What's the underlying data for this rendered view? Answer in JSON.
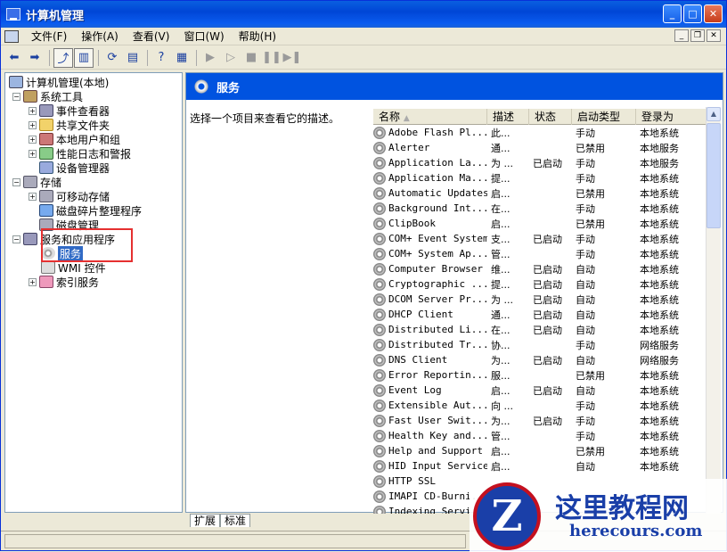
{
  "window": {
    "title": "计算机管理"
  },
  "menu": [
    "文件(F)",
    "操作(A)",
    "查看(V)",
    "窗口(W)",
    "帮助(H)"
  ],
  "tree": {
    "root": "计算机管理(本地)",
    "system_tools": "系统工具",
    "event_viewer": "事件查看器",
    "shared_folders": "共享文件夹",
    "local_users": "本地用户和组",
    "perf_logs": "性能日志和警报",
    "device_manager": "设备管理器",
    "storage": "存储",
    "removable": "可移动存储",
    "defrag": "磁盘碎片整理程序",
    "disk_mgmt": "磁盘管理",
    "services_apps": "服务和应用程序",
    "services": "服务",
    "wmi": "WMI 控件",
    "indexing": "索引服务"
  },
  "panel": {
    "title": "服务",
    "description": "选择一个项目来查看它的描述。"
  },
  "columns": [
    "名称",
    "描述",
    "状态",
    "启动类型",
    "登录为"
  ],
  "services": [
    {
      "name": "Adobe Flash Pl...",
      "desc": "此...",
      "status": "",
      "startup": "手动",
      "logon": "本地系统"
    },
    {
      "name": "Alerter",
      "desc": "通...",
      "status": "",
      "startup": "已禁用",
      "logon": "本地服务"
    },
    {
      "name": "Application La...",
      "desc": "为 ...",
      "status": "已启动",
      "startup": "手动",
      "logon": "本地服务"
    },
    {
      "name": "Application Ma...",
      "desc": "提...",
      "status": "",
      "startup": "手动",
      "logon": "本地系统"
    },
    {
      "name": "Automatic Updates",
      "desc": "启...",
      "status": "",
      "startup": "已禁用",
      "logon": "本地系统"
    },
    {
      "name": "Background Int...",
      "desc": "在...",
      "status": "",
      "startup": "手动",
      "logon": "本地系统"
    },
    {
      "name": "ClipBook",
      "desc": "启...",
      "status": "",
      "startup": "已禁用",
      "logon": "本地系统"
    },
    {
      "name": "COM+ Event System",
      "desc": "支...",
      "status": "已启动",
      "startup": "手动",
      "logon": "本地系统"
    },
    {
      "name": "COM+ System Ap...",
      "desc": "管...",
      "status": "",
      "startup": "手动",
      "logon": "本地系统"
    },
    {
      "name": "Computer Browser",
      "desc": "维...",
      "status": "已启动",
      "startup": "自动",
      "logon": "本地系统"
    },
    {
      "name": "Cryptographic ...",
      "desc": "提...",
      "status": "已启动",
      "startup": "自动",
      "logon": "本地系统"
    },
    {
      "name": "DCOM Server Pr...",
      "desc": "为 ...",
      "status": "已启动",
      "startup": "自动",
      "logon": "本地系统"
    },
    {
      "name": "DHCP Client",
      "desc": "通...",
      "status": "已启动",
      "startup": "自动",
      "logon": "本地系统"
    },
    {
      "name": "Distributed Li...",
      "desc": "在...",
      "status": "已启动",
      "startup": "自动",
      "logon": "本地系统"
    },
    {
      "name": "Distributed Tr...",
      "desc": "协...",
      "status": "",
      "startup": "手动",
      "logon": "网络服务"
    },
    {
      "name": "DNS Client",
      "desc": "为...",
      "status": "已启动",
      "startup": "自动",
      "logon": "网络服务"
    },
    {
      "name": "Error Reportin...",
      "desc": "服...",
      "status": "",
      "startup": "已禁用",
      "logon": "本地系统"
    },
    {
      "name": "Event Log",
      "desc": "启...",
      "status": "已启动",
      "startup": "自动",
      "logon": "本地系统"
    },
    {
      "name": "Extensible Aut...",
      "desc": "向 ...",
      "status": "",
      "startup": "手动",
      "logon": "本地系统"
    },
    {
      "name": "Fast User Swit...",
      "desc": "为...",
      "status": "已启动",
      "startup": "手动",
      "logon": "本地系统"
    },
    {
      "name": "Health Key and...",
      "desc": "管...",
      "status": "",
      "startup": "手动",
      "logon": "本地系统"
    },
    {
      "name": "Help and Support",
      "desc": "启...",
      "status": "",
      "startup": "已禁用",
      "logon": "本地系统"
    },
    {
      "name": "HID Input Service",
      "desc": "启...",
      "status": "",
      "startup": "自动",
      "logon": "本地系统"
    },
    {
      "name": "HTTP SSL",
      "desc": "",
      "status": "",
      "startup": "",
      "logon": ""
    },
    {
      "name": "IMAPI CD-Burni...",
      "desc": "",
      "status": "",
      "startup": "",
      "logon": ""
    },
    {
      "name": "Indexing Servi...",
      "desc": "",
      "status": "",
      "startup": "",
      "logon": ""
    }
  ],
  "tabs": [
    "扩展",
    "标准"
  ],
  "watermark": {
    "logo": "Z",
    "cn": "这里教程网",
    "en": "herecours.com"
  }
}
